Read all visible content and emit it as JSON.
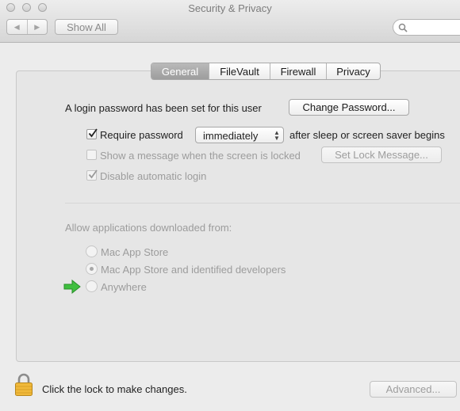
{
  "window": {
    "title": "Security & Privacy",
    "nav_back_icon": "back-arrow-icon",
    "nav_forward_icon": "forward-arrow-icon",
    "show_all_label": "Show All",
    "search_placeholder": ""
  },
  "tabs": [
    {
      "label": "General",
      "active": true
    },
    {
      "label": "FileVault",
      "active": false
    },
    {
      "label": "Firewall",
      "active": false
    },
    {
      "label": "Privacy",
      "active": false
    }
  ],
  "general": {
    "login_text": "A login password has been set for this user",
    "change_password_label": "Change Password...",
    "require_password_label": "Require password",
    "require_password_checked": true,
    "require_password_delay": "immediately",
    "after_sleep_text": "after sleep or screen saver begins",
    "show_message_label": "Show a message when the screen is locked",
    "show_message_checked": false,
    "set_lock_message_label": "Set Lock Message...",
    "disable_login_label": "Disable automatic login",
    "disable_login_checked": true
  },
  "downloads": {
    "heading": "Allow applications downloaded from:",
    "options": [
      {
        "label": "Mac App Store",
        "selected": false
      },
      {
        "label": "Mac App Store and identified developers",
        "selected": true
      },
      {
        "label": "Anywhere",
        "selected": false
      }
    ],
    "pointer_icon": "green-arrow-icon",
    "pointer_color": "#3fbf3f"
  },
  "footer": {
    "lock_icon": "lock-icon",
    "lock_text": "Click the lock to make changes.",
    "advanced_label": "Advanced..."
  }
}
